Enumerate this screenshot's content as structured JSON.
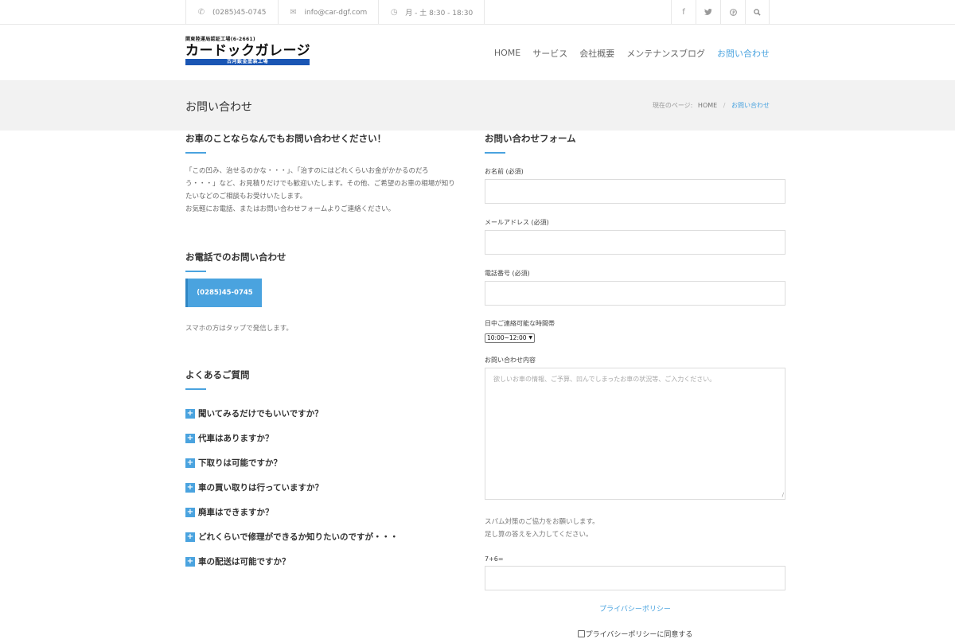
{
  "topbar": {
    "phone": "(0285)45-0745",
    "email": "info@car-dgf.com",
    "hours": "月 - 土 8:30 - 18:30",
    "icons": {
      "phone": "phone-icon",
      "email": "envelope-icon",
      "hours": "clock-icon"
    },
    "social": [
      "facebook-icon",
      "twitter-icon",
      "pinterest-icon",
      "search-icon"
    ]
  },
  "logo": {
    "top": "関東陸運局認証工場(6-2661)",
    "main": "カードックガレージ",
    "sub": "古河鈑金塗装工場"
  },
  "nav": [
    "HOME",
    "サービス",
    "会社概要",
    "メンテナンスブログ",
    "お問い合わせ"
  ],
  "nav_active_index": 4,
  "page_title": "お問い合わせ",
  "breadcrumb": {
    "prefix": "現在のページ:",
    "home": "HOME",
    "separator": "/",
    "current": "お問い合わせ"
  },
  "left": {
    "intro_title": "お車のことならなんでもお問い合わせください！",
    "intro_lines": [
      "「この凹み、治せるのかな・・・」、「治すのにはどれくらいお金がかかるのだろ",
      "う・・・」など、お見積りだけでも歓迎いたします。その他、ご希望のお車の相場が知り",
      "たいなどのご相談もお受けいたします。",
      "お気軽にお電話、またはお問い合わせフォームよりご連絡ください。"
    ],
    "phone_title": "お電話でのお問い合わせ",
    "phone_button": "(0285)45-0745",
    "phone_note": "スマホの方はタップで発信します。",
    "faq_title": "よくあるご質問",
    "faq": [
      "聞いてみるだけでもいいですか？",
      "代車はありますか？",
      "下取りは可能ですか？",
      "車の買い取りは行っていますか？",
      "廃車はできますか？",
      "どれくらいで修理ができるか知りたいのですが・・・",
      "車の配送は可能ですか？"
    ]
  },
  "form": {
    "title": "お問い合わせフォーム",
    "name_label": "お名前 (必須)",
    "email_label": "メールアドレス (必須)",
    "tel_label": "電話番号 (必須)",
    "time_label": "日中ご連絡可能な時間帯",
    "time_value": "10:00~12:00",
    "message_label": "お問い合わせ内容",
    "message_placeholder": "欲しいお車の情報、ご予算、凹んでしまったお車の状況等、ご入力ください。",
    "spam_note_1": "スパム対策のご協力をお願いします。",
    "spam_note_2": "足し算の答えを入力してください。",
    "captcha_label": "7+6=",
    "privacy_link": "プライバシーポリシー",
    "agree_label": "プライバシーポリシーに同意する"
  },
  "colors": {
    "accent": "#4aa3df",
    "logo_bar": "#1a56b4"
  }
}
